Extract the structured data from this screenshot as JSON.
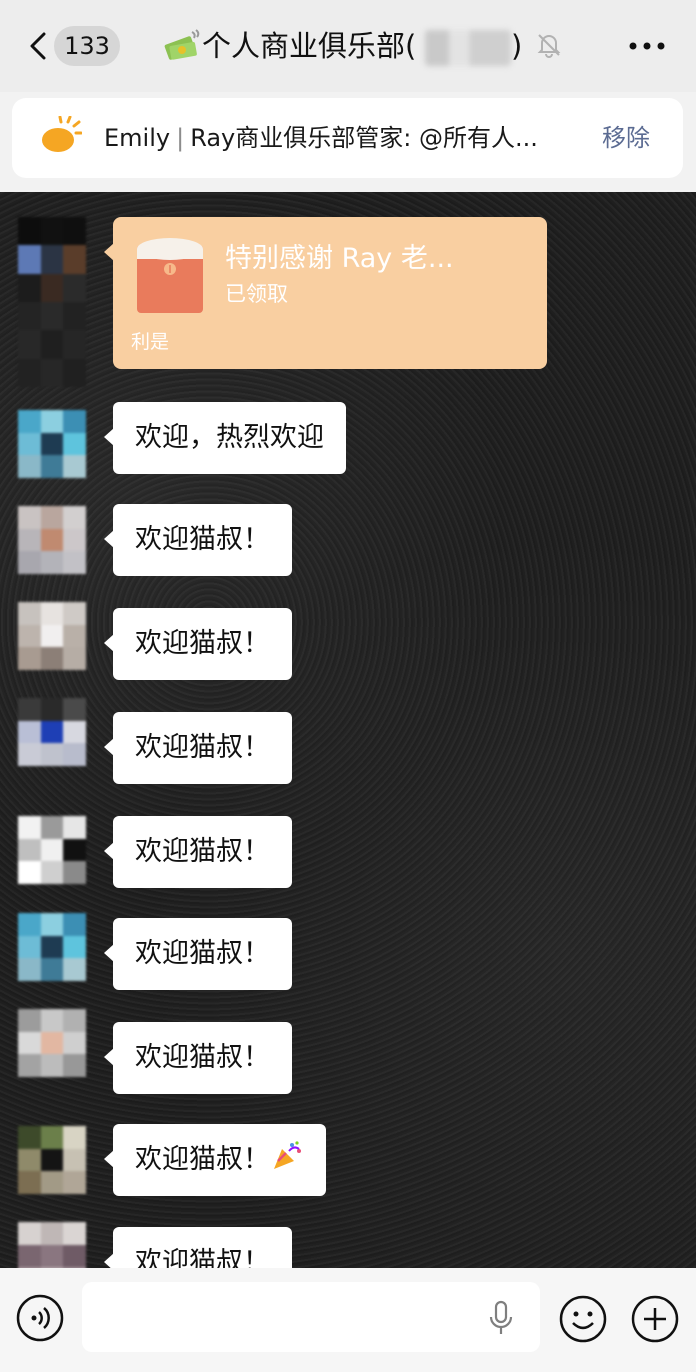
{
  "nav": {
    "back_count": "133",
    "title": "个人商业俱乐部(",
    "title_close": ")"
  },
  "pinned": {
    "sender": "Emily",
    "separator": "|",
    "text": "Ray商业俱乐部管家: @所有人...",
    "remove_label": "移除"
  },
  "red_packet": {
    "title": "特别感谢 Ray 老...",
    "status": "已领取",
    "label": "利是"
  },
  "messages": [
    {
      "text": "欢迎，热烈欢迎"
    },
    {
      "text": "欢迎猫叔！"
    },
    {
      "text": "欢迎猫叔！"
    },
    {
      "text": "欢迎猫叔！"
    },
    {
      "text": "欢迎猫叔！"
    },
    {
      "text": "欢迎猫叔！"
    },
    {
      "text": "欢迎猫叔！"
    },
    {
      "text": "欢迎猫叔！"
    },
    {
      "text": "欢迎猫叔！"
    }
  ],
  "colors": {
    "chat_bg": "#222222",
    "bubble": "#ffffff",
    "packet": "#f9cfa1",
    "remove_link": "#5b6b92"
  },
  "icons": [
    "back-chevron-icon",
    "money-emoji-icon",
    "mute-bell-icon",
    "more-icon",
    "sun-icon",
    "red-packet-icon",
    "party-popper-icon",
    "voice-icon",
    "microphone-icon",
    "emoji-icon",
    "plus-icon"
  ]
}
